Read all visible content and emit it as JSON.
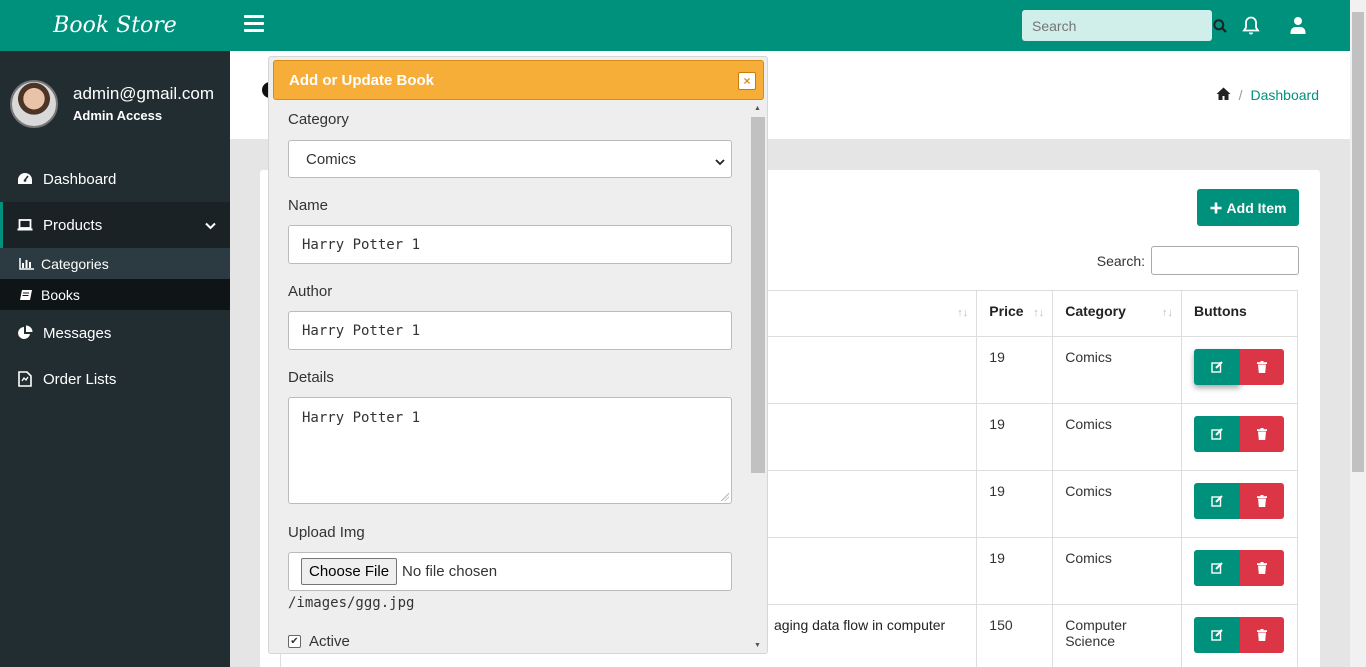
{
  "brand": "Book Store",
  "user": {
    "email": "admin@gmail.com",
    "role": "Admin Access"
  },
  "sidebar": {
    "items": [
      {
        "label": "Dashboard",
        "icon": "dashboard-icon"
      },
      {
        "label": "Products",
        "icon": "laptop-icon"
      },
      {
        "label": "Messages",
        "icon": "pie-chart-icon"
      },
      {
        "label": "Order Lists",
        "icon": "document-icon"
      }
    ],
    "subitems": [
      {
        "label": "Categories",
        "icon": "bar-chart-icon"
      },
      {
        "label": "Books",
        "icon": "book-icon"
      }
    ]
  },
  "topbar": {
    "search_placeholder": "Search"
  },
  "breadcrumb": {
    "current": "Dashboard"
  },
  "content": {
    "add_label": "Add Item",
    "search_label": "Search:"
  },
  "table": {
    "headers": {
      "price": "Price",
      "category": "Category",
      "buttons": "Buttons"
    },
    "rows": [
      {
        "details": "",
        "price": "19",
        "category": "Comics"
      },
      {
        "details": "",
        "price": "19",
        "category": "Comics"
      },
      {
        "details": "",
        "price": "19",
        "category": "Comics"
      },
      {
        "details": "",
        "price": "19",
        "category": "Comics"
      },
      {
        "details": "aging data flow in computer",
        "price": "150",
        "category": "Computer Science"
      }
    ]
  },
  "modal": {
    "title": "Add or Update Book",
    "close": "×",
    "category_label": "Category",
    "category_value": "Comics",
    "name_label": "Name",
    "name_value": "Harry Potter 1",
    "author_label": "Author",
    "author_value": "Harry Potter 1",
    "details_label": "Details",
    "details_value": "Harry Potter 1",
    "upload_label": "Upload Img",
    "choose_file": "Choose File",
    "no_file": "No file chosen",
    "img_path": "/images/ggg.jpg",
    "active_label": "Active",
    "active_checked": true
  },
  "colors": {
    "primary": "#00917c",
    "sidebar": "#222d32",
    "modal_header": "#f6ae38",
    "danger": "#dc3545"
  }
}
